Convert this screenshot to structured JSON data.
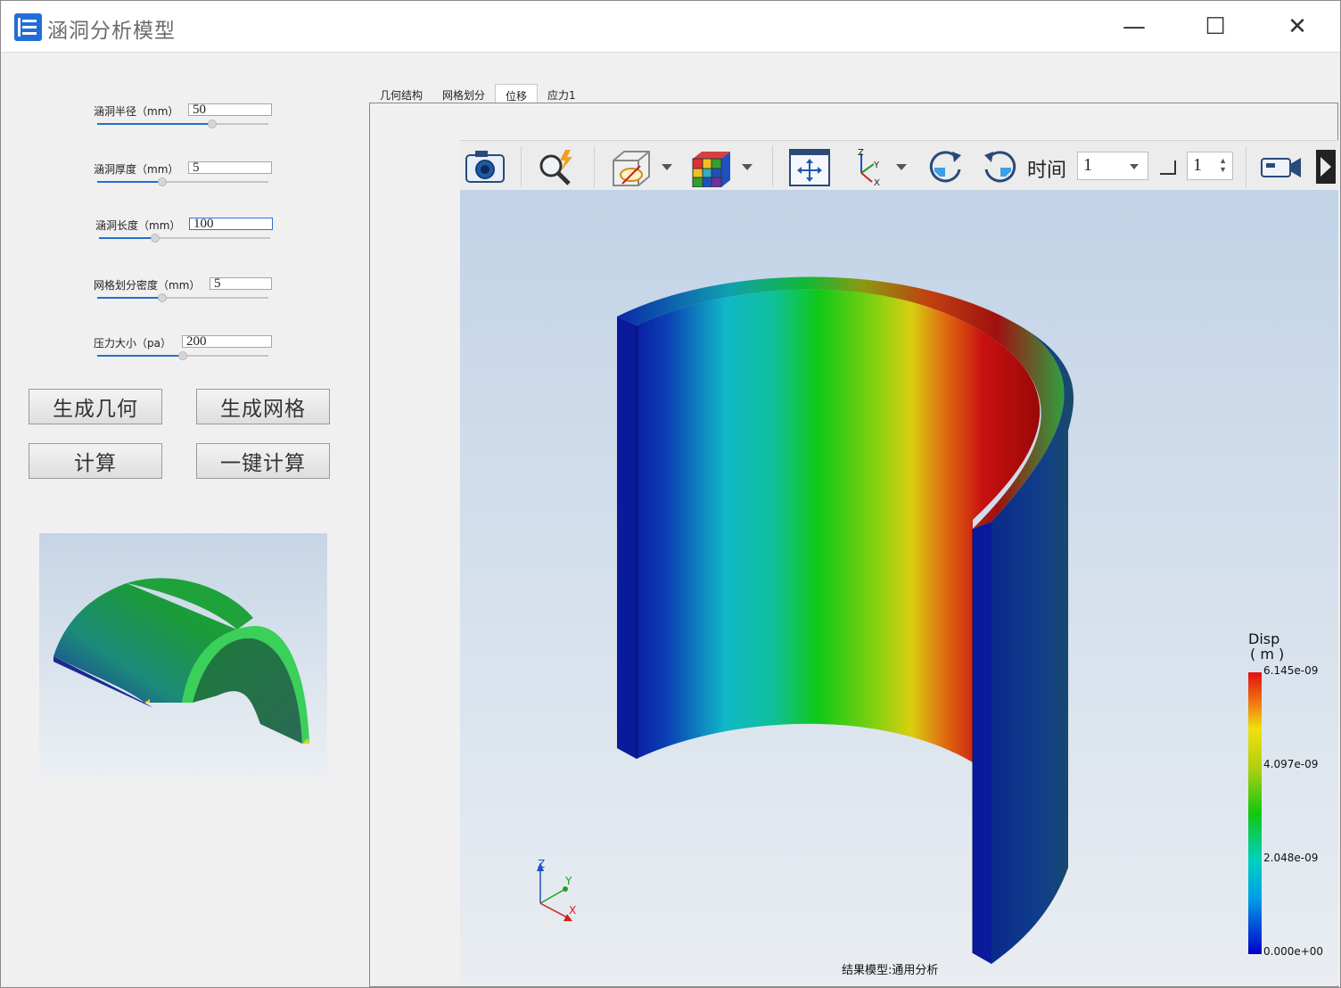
{
  "window": {
    "title": "涵洞分析模型",
    "minimize_glyph": "—",
    "maximize_glyph": "☐",
    "close_glyph": "✕"
  },
  "params": [
    {
      "label": "涵洞半径（mm）",
      "value": "50",
      "slider_fraction": 0.67
    },
    {
      "label": "涵洞厚度（mm）",
      "value": "5",
      "slider_fraction": 0.38
    },
    {
      "label": "涵洞长度（mm）",
      "value": "100",
      "slider_fraction": 0.33
    },
    {
      "label": "网格划分密度（mm）",
      "value": "5",
      "slider_fraction": 0.38
    },
    {
      "label": "压力大小（pa）",
      "value": "200",
      "slider_fraction": 0.5
    }
  ],
  "buttons": {
    "generate_geometry": "生成几何",
    "generate_mesh": "生成网格",
    "compute": "计算",
    "one_click_compute": "一键计算"
  },
  "tabs": [
    {
      "label": "几何结构",
      "active": false
    },
    {
      "label": "网格划分",
      "active": false
    },
    {
      "label": "位移",
      "active": true
    },
    {
      "label": "应力1",
      "active": false
    }
  ],
  "toolbar": {
    "icons": [
      "camera-icon",
      "probe-icon",
      "display-mode-icon",
      "color-cube-icon",
      "fit-view-icon",
      "axes-orientation-icon",
      "rotate-cw-icon",
      "rotate-ccw-icon",
      "record-video-icon"
    ],
    "time_label": "时间",
    "time_value": "1",
    "step_value": "1"
  },
  "legend": {
    "title": "Disp",
    "unit": "( m )",
    "ticks": [
      "6.145e-09",
      "4.097e-09",
      "2.048e-09",
      "0.000e+00"
    ]
  },
  "viewport": {
    "result_label": "结果模型:通用分析",
    "triad": {
      "x": "X",
      "y": "Y",
      "z": "Z"
    }
  },
  "colors": {
    "accent": "#2470c8",
    "app_icon": "#1f6fd6"
  }
}
